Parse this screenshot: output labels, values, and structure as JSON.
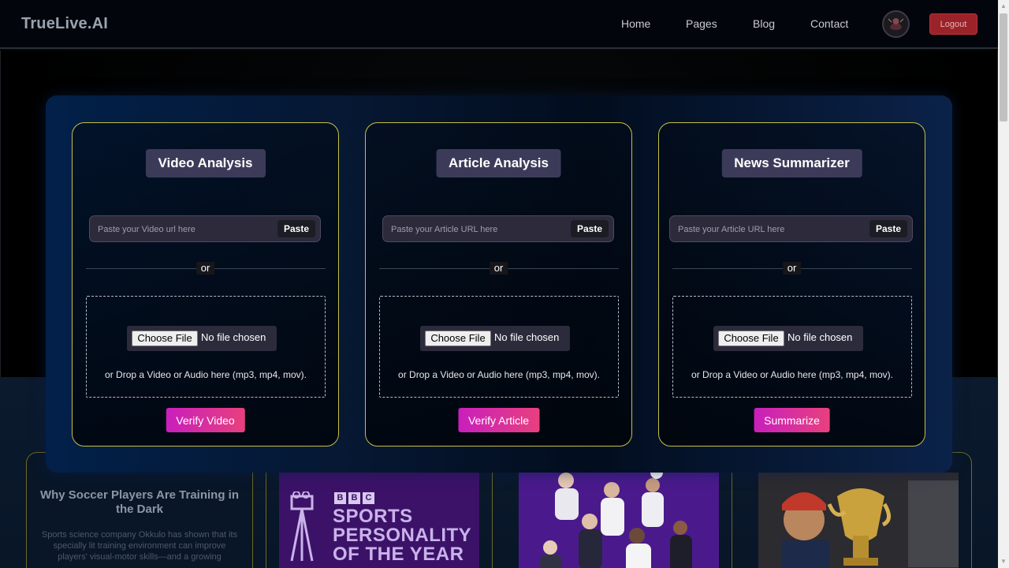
{
  "navbar": {
    "brand": "TrueLive.AI",
    "links": [
      "Home",
      "Pages",
      "Blog",
      "Contact"
    ],
    "logout_label": "Logout"
  },
  "tools": [
    {
      "title": "Video Analysis",
      "url_placeholder": "Paste your Video url here",
      "paste_label": "Paste",
      "or_label": "or",
      "choose_file_label": "Choose File",
      "file_status": "No file chosen",
      "drop_hint": "or Drop a Video or Audio here (mp3, mp4, mov).",
      "action_label": "Verify Video"
    },
    {
      "title": "Article Analysis",
      "url_placeholder": "Paste your Article URL here",
      "paste_label": "Paste",
      "or_label": "or",
      "choose_file_label": "Choose File",
      "file_status": "No file chosen",
      "drop_hint": "or Drop a Video or Audio here (mp3, mp4, mov).",
      "action_label": "Verify Article"
    },
    {
      "title": "News Summarizer",
      "url_placeholder": "Paste your Article URL here",
      "paste_label": "Paste",
      "or_label": "or",
      "choose_file_label": "Choose File",
      "file_status": "No file chosen",
      "drop_hint": "or Drop a Video or Audio here (mp3, mp4, mov).",
      "action_label": "Summarize"
    }
  ],
  "articles": {
    "first_title": "Why Soccer Players Are Training in the Dark",
    "first_desc": "Sports science company Okkulo has shown that its specially lit training environment can improve players' visual-motor skills—and a growing",
    "bbc_letters": [
      "B",
      "B",
      "C"
    ],
    "bbc_lines": [
      "SPORTS",
      "PERSONALITY",
      "OF THE YEAR"
    ]
  },
  "colors": {
    "accent_gradient_start": "#c81fbd",
    "accent_gradient_end": "#e8407e",
    "card_border": "#c7c046",
    "logout_bg": "#9b2229"
  }
}
